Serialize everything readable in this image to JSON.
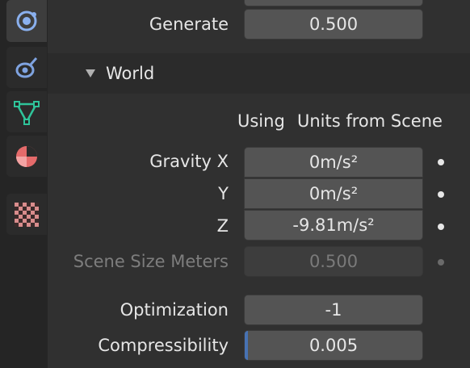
{
  "tabs": [
    {
      "icon": "physics-icon",
      "active": true
    },
    {
      "icon": "constraints-icon",
      "active": false
    },
    {
      "icon": "object-data-icon",
      "active": false
    },
    {
      "icon": "material-icon",
      "active": false
    },
    {
      "icon": "texture-icon",
      "active": false
    }
  ],
  "generate": {
    "label": "Generate",
    "value": "0.500"
  },
  "world": {
    "title": "World",
    "using_label": "Using",
    "units_value": "Units from Scene",
    "gravity": {
      "x_label": "Gravity X",
      "x_value": "0m/s²",
      "y_label": "Y",
      "y_value": "0m/s²",
      "z_label": "Z",
      "z_value": "-9.81m/s²"
    },
    "scene_size": {
      "label": "Scene Size Meters",
      "value": "0.500"
    },
    "optimization": {
      "label": "Optimization",
      "value": "-1"
    },
    "compressibility": {
      "label": "Compressibility",
      "value": "0.005",
      "fraction": 0.02
    }
  },
  "colors": {
    "accent": "#4772b3",
    "physics_icon": "#7fa3e0",
    "object_data_icon": "#2fc49a",
    "material_icon": "#e46a6a",
    "texture_icon": "#d98c8c"
  }
}
